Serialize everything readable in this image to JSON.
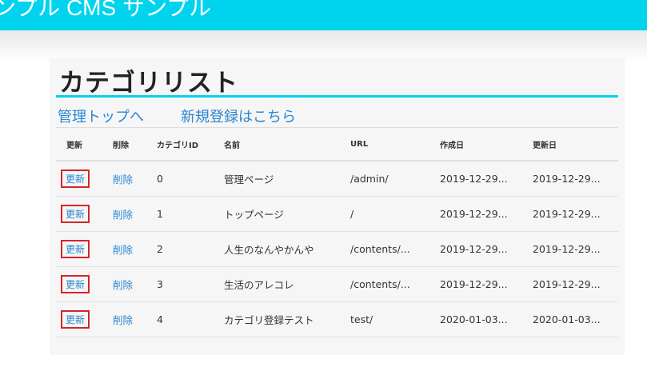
{
  "header": {
    "title": "ンプル CMS サンプル"
  },
  "page": {
    "title": "カテゴリリスト"
  },
  "nav": {
    "top_link": "管理トップへ",
    "new_link": "新規登録はこちら"
  },
  "table": {
    "columns": [
      "更新",
      "削除",
      "カテゴリID",
      "名前",
      "URL",
      "作成日",
      "更新日"
    ],
    "rows": [
      {
        "update": "更新",
        "delete": "削除",
        "id": "0",
        "name": "管理ページ",
        "url": "/admin/",
        "created": "2019-12-29...",
        "updated": "2019-12-29..."
      },
      {
        "update": "更新",
        "delete": "削除",
        "id": "1",
        "name": "トップページ",
        "url": "/",
        "created": "2019-12-29...",
        "updated": "2019-12-29..."
      },
      {
        "update": "更新",
        "delete": "削除",
        "id": "2",
        "name": "人生のなんやかんや",
        "url": "/contents/...",
        "created": "2019-12-29...",
        "updated": "2019-12-29..."
      },
      {
        "update": "更新",
        "delete": "削除",
        "id": "3",
        "name": "生活のアレコレ",
        "url": "/contents/...",
        "created": "2019-12-29...",
        "updated": "2019-12-29..."
      },
      {
        "update": "更新",
        "delete": "削除",
        "id": "4",
        "name": "カテゴリ登録テスト",
        "url": "test/",
        "created": "2020-01-03...",
        "updated": "2020-01-03..."
      }
    ]
  },
  "colors": {
    "accent": "#00d3ee",
    "link": "#2a86d0",
    "highlight": "#d6232a"
  }
}
